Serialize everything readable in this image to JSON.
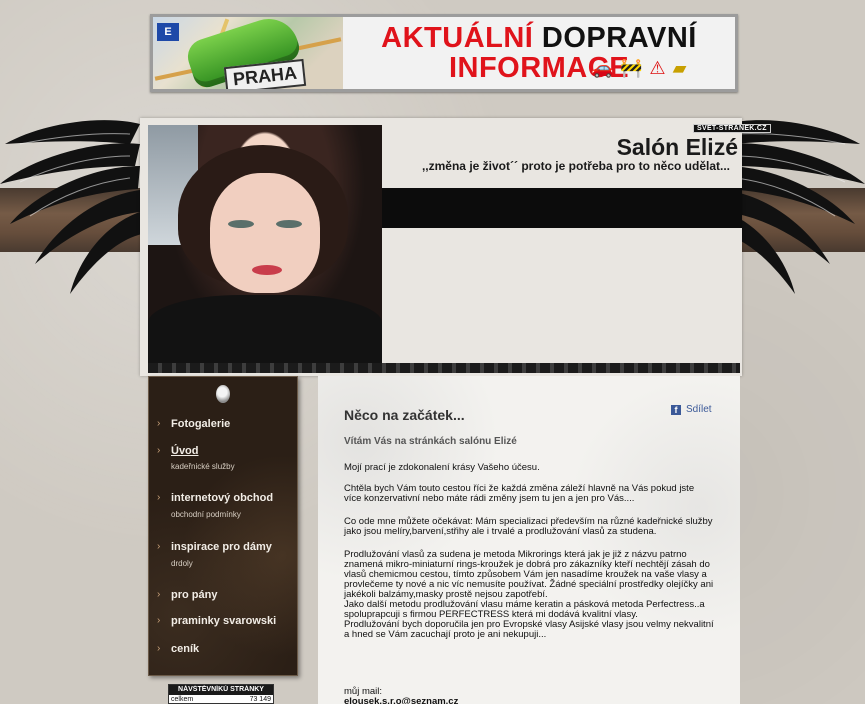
{
  "banner": {
    "title_part1": "AKTUÁLNÍ",
    "title_part2": "DOPRAVNÍ",
    "title_line2": "INFORMACE",
    "map_label": "PRAHA",
    "eu_label": "E",
    "icons": [
      "car-crash-icon",
      "roadworks-icon",
      "warning-icon",
      "barrier-icon"
    ]
  },
  "header": {
    "site_badge": "SVET-STRANEK.CZ",
    "title": "Salón Elizé",
    "subtitle": ",,změna je život´´ proto je potřeba pro to něco udělat..."
  },
  "sidebar": {
    "items": [
      {
        "label": "Fotogalerie",
        "sub": ""
      },
      {
        "label": "Úvod",
        "sub": "kadeřnické služby",
        "active": true
      },
      {
        "label": "internetový obchod",
        "sub": "obchodní podmínky"
      },
      {
        "label": "inspirace pro dámy",
        "sub": "drdoly"
      },
      {
        "label": "pro pány",
        "sub": ""
      },
      {
        "label": "praminky svarowski",
        "sub": ""
      },
      {
        "label": "ceník",
        "sub": ""
      }
    ]
  },
  "counter": {
    "heading": "NÁVŠTĚVNÍKŮ STRÁNKY",
    "label": "celkem",
    "value": "73 149"
  },
  "content": {
    "title": "Něco na začátek...",
    "share_label": "Sdílet",
    "welcome": "Vítám Vás na stránkách salónu Elizé",
    "paragraphs": [
      "Mojí prací je zdokonalení krásy Vašeho účesu.",
      "Chtěla bych Vám touto cestou říci že každá změna záleží hlavně na Vás pokud jste více konzervativní nebo máte rádi změny jsem tu jen a jen pro Vás....",
      "Co ode mne můžete očekávat: Mám specializaci především na různé kadeřnické služby jako jsou melíry,barvení,střihy ale i trvalé a prodlužování vlasů za studena.",
      "Prodlužování vlasů za sudena je metoda Mikrorings která jak je již z názvu patrno znamená mikro-miniaturní rings-kroužek je dobrá pro zákazníky kteří nechtějí zásah do vlasů chemicmou cestou, tímto způsobem Vám jen nasadíme kroužek na vaše vlasy a provlečeme ty nové a nic víc nemusíte používat. Žádné speciální prostředky olejíčky ani jakékoli balzámy,masky prostě nejsou zapotřebí.\nJako další metodu prodlužování vlasu máme keratin a pásková metoda Perfectress..a spoluprapcuji s firmou PERFECTRESS která mi dodává kvalitní vlasy.\nProdlužování bych doporučila jen pro Evropské vlasy Asijské vlasy jsou velmy nekvalitní a hned se Vám zacuchají proto je ani nekupuji..."
    ],
    "mail_label": "můj mail:",
    "mail_value": "elousek.s.r.o@seznam.cz"
  }
}
